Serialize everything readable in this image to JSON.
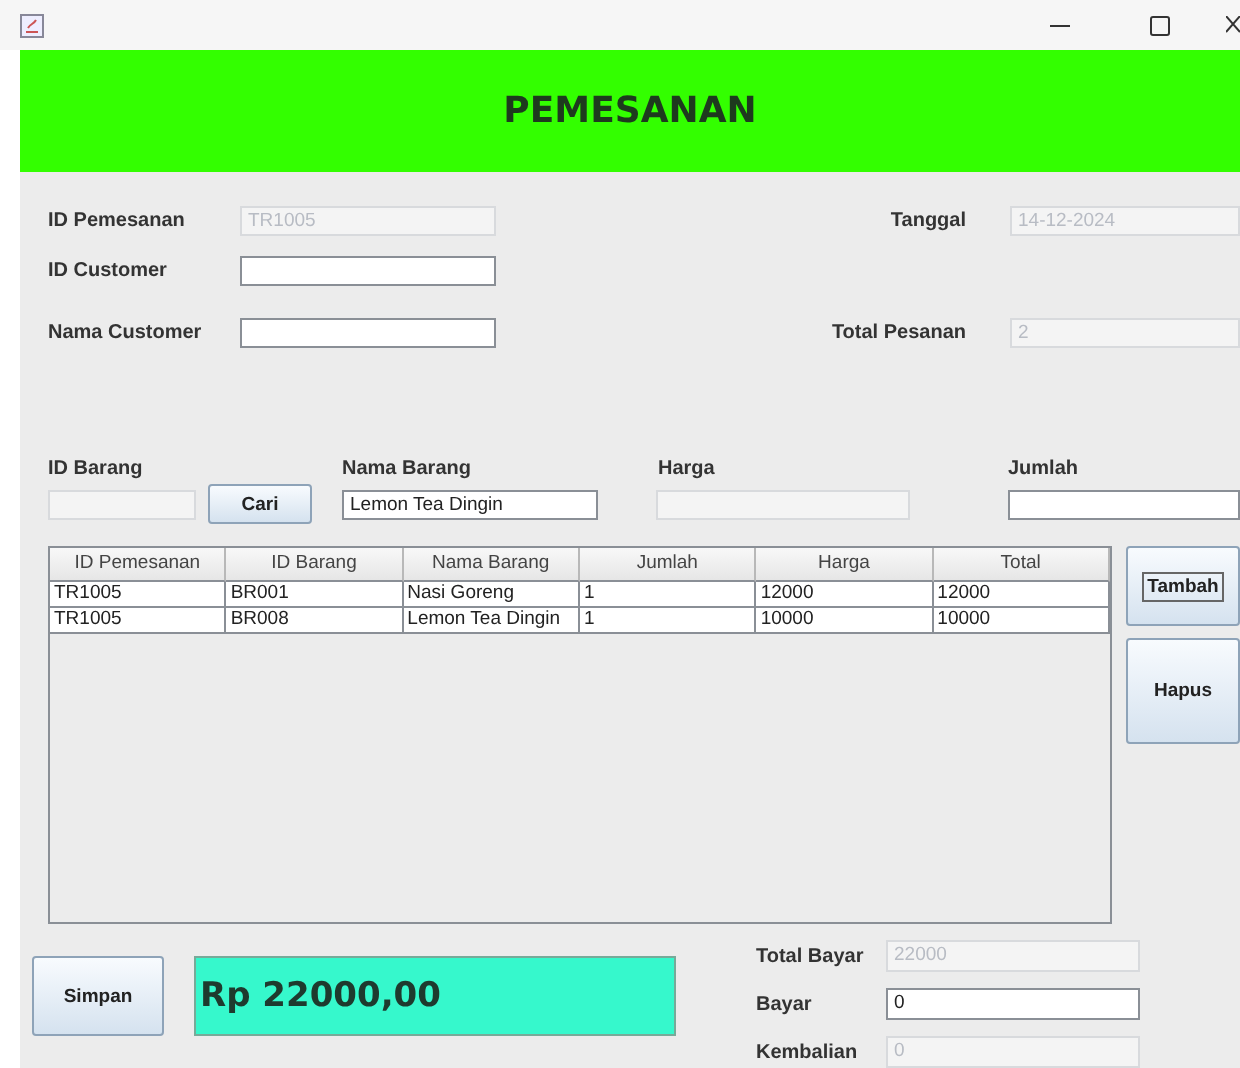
{
  "header": {
    "title": "PEMESANAN"
  },
  "id_pemesanan": {
    "label": "ID Pemesanan",
    "value": "TR1005",
    "disabled": true
  },
  "tanggal": {
    "label": "Tanggal",
    "value": "14-12-2024",
    "disabled": true
  },
  "id_customer": {
    "label": "ID Customer",
    "disabled": false
  },
  "nama_customer": {
    "label": "Nama Customer",
    "disabled": false
  },
  "total_pesanan": {
    "label": "Total Pesanan",
    "value": "2",
    "disabled": true
  },
  "id_barang": {
    "label": "ID Barang",
    "disabled": true
  },
  "cari_button": "Cari",
  "nama_barang": {
    "label": "Nama Barang",
    "value": "Lemon Tea Dingin",
    "disabled": false
  },
  "harga": {
    "label": "Harga",
    "disabled": true
  },
  "jumlah": {
    "label": "Jumlah",
    "disabled": false
  },
  "table": {
    "columns": [
      "ID Pemesanan",
      "ID Barang",
      "Nama Barang",
      "Jumlah",
      "Harga",
      "Total"
    ],
    "rows": [
      [
        "TR1005",
        "BR001",
        "Nasi Goreng",
        "1",
        "12000",
        "12000"
      ],
      [
        "TR1005",
        "BR008",
        "Lemon Tea Dingin",
        "1",
        "10000",
        "10000"
      ]
    ]
  },
  "tambah_button": "Tambah",
  "hapus_button": "Hapus",
  "simpan_button": "Simpan",
  "total_display": "Rp 22000,00",
  "total_bayar": {
    "label": "Total Bayar",
    "value": "22000",
    "disabled": true
  },
  "bayar": {
    "label": "Bayar",
    "value": "0",
    "disabled": false
  },
  "kembalian": {
    "label": "Kembalian",
    "value": "0",
    "disabled": true
  }
}
